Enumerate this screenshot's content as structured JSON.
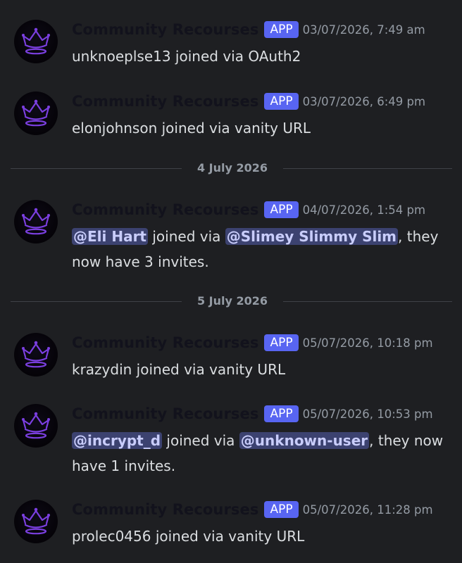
{
  "messages": [
    {
      "author": "Community Recourses",
      "badge": "APP",
      "timestamp": "03/07/2026, 7:49 am",
      "text": "unknoeplse13 joined via OAuth2"
    },
    {
      "author": "Community Recourses",
      "badge": "APP",
      "timestamp": "03/07/2026, 6:49 pm",
      "text": "elonjohnson joined via vanity URL"
    },
    {
      "author": "Community Recourses",
      "badge": "APP",
      "timestamp": "04/07/2026, 1:54 pm",
      "mention_user": "@Eli Hart",
      "text_mid": " joined via ",
      "mention_inviter": "@Slimey Slimmy Slim",
      "text_end": ", they now have 3 invites."
    },
    {
      "author": "Community Recourses",
      "badge": "APP",
      "timestamp": "05/07/2026, 10:18 pm",
      "text": "krazydin joined via vanity URL"
    },
    {
      "author": "Community Recourses",
      "badge": "APP",
      "timestamp": "05/07/2026, 10:53 pm",
      "mention_user": "@incrypt_d",
      "text_mid": " joined via ",
      "mention_inviter": "@unknown-user",
      "text_end": ", they now have 1 invites."
    },
    {
      "author": "Community Recourses",
      "badge": "APP",
      "timestamp": "05/07/2026, 11:28 pm",
      "text": "prolec0456 joined via vanity URL"
    }
  ],
  "dividers": [
    "4 July 2026",
    "5 July 2026"
  ],
  "icons": {
    "avatar": "crown-icon"
  },
  "colors": {
    "background": "#1e1f22",
    "app_badge": "#5865f2",
    "mention_bg": "#3c4270",
    "crown": "#7b3fe0"
  }
}
